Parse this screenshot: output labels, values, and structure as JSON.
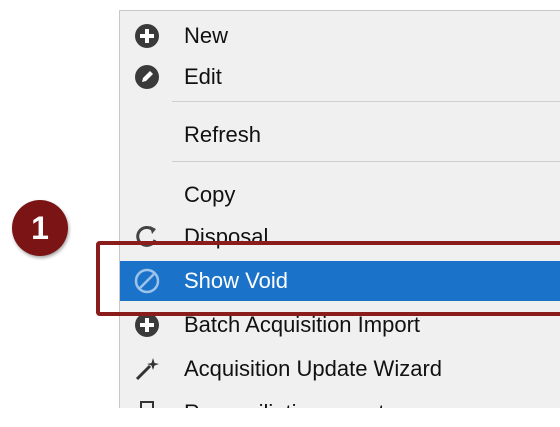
{
  "menu": {
    "items": [
      {
        "key": "new",
        "label": "New",
        "icon": "plus-circle-icon"
      },
      {
        "key": "edit",
        "label": "Edit",
        "icon": "pencil-circle-icon"
      },
      {
        "key": "refresh",
        "label": "Refresh",
        "icon": ""
      },
      {
        "key": "copy",
        "label": "Copy",
        "icon": ""
      },
      {
        "key": "disposal",
        "label": "Disposal",
        "icon": "refresh-arrow-icon"
      },
      {
        "key": "show_void",
        "label": "Show Void",
        "icon": "prohibited-icon",
        "selected": true
      },
      {
        "key": "batch",
        "label": "Batch Acquisition Import",
        "icon": "plus-circle-icon"
      },
      {
        "key": "wizard",
        "label": "Acquisition Update Wizard",
        "icon": "magic-wand-icon"
      },
      {
        "key": "reconciliation",
        "label": "Reconciliation report",
        "icon": "printer-icon"
      }
    ]
  },
  "callout": {
    "number": "1"
  },
  "colors": {
    "accent": "#1a73c9",
    "callout": "#7b1515"
  }
}
